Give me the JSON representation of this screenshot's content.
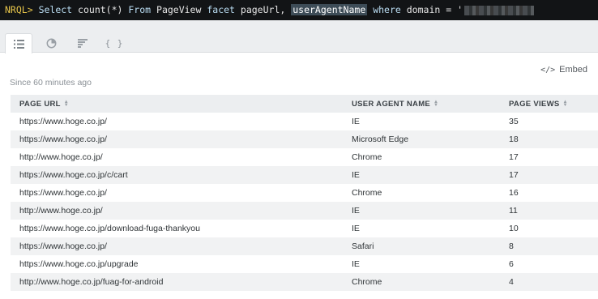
{
  "query": {
    "prompt": "NRQL>",
    "kw_select": "Select",
    "func": "count(*)",
    "kw_from": "From",
    "event": "PageView",
    "kw_facet": "facet",
    "facet1": "pageUrl,",
    "facet2": "userAgentName",
    "kw_where": "where",
    "attr": "domain",
    "op": "=",
    "quote": "'"
  },
  "tabs": [
    {
      "icon": "list-icon",
      "active": true
    },
    {
      "icon": "refresh-chart-icon",
      "active": false
    },
    {
      "icon": "bar-list-icon",
      "active": false
    },
    {
      "icon": "json-braces-icon",
      "label": "{ }",
      "active": false
    }
  ],
  "embed_label": "Embed",
  "embed_icon": "</>",
  "since_label": "Since 60 minutes ago",
  "table": {
    "headers": [
      "PAGE URL",
      "USER AGENT NAME",
      "PAGE VIEWS"
    ],
    "rows": [
      [
        "https://www.hoge.co.jp/",
        "IE",
        "35"
      ],
      [
        "https://www.hoge.co.jp/",
        "Microsoft Edge",
        "18"
      ],
      [
        "http://www.hoge.co.jp/",
        "Chrome",
        "17"
      ],
      [
        "https://www.hoge.co.jp/c/cart",
        "IE",
        "17"
      ],
      [
        "https://www.hoge.co.jp/",
        "Chrome",
        "16"
      ],
      [
        "http://www.hoge.co.jp/",
        "IE",
        "11"
      ],
      [
        "https://www.hoge.co.jp/download-fuga-thankyou",
        "IE",
        "10"
      ],
      [
        "https://www.hoge.co.jp/",
        "Safari",
        "8"
      ],
      [
        "https://www.hoge.co.jp/upgrade",
        "IE",
        "6"
      ],
      [
        "http://www.hoge.co.jp/fuag-for-android",
        "Chrome",
        "4"
      ]
    ]
  }
}
